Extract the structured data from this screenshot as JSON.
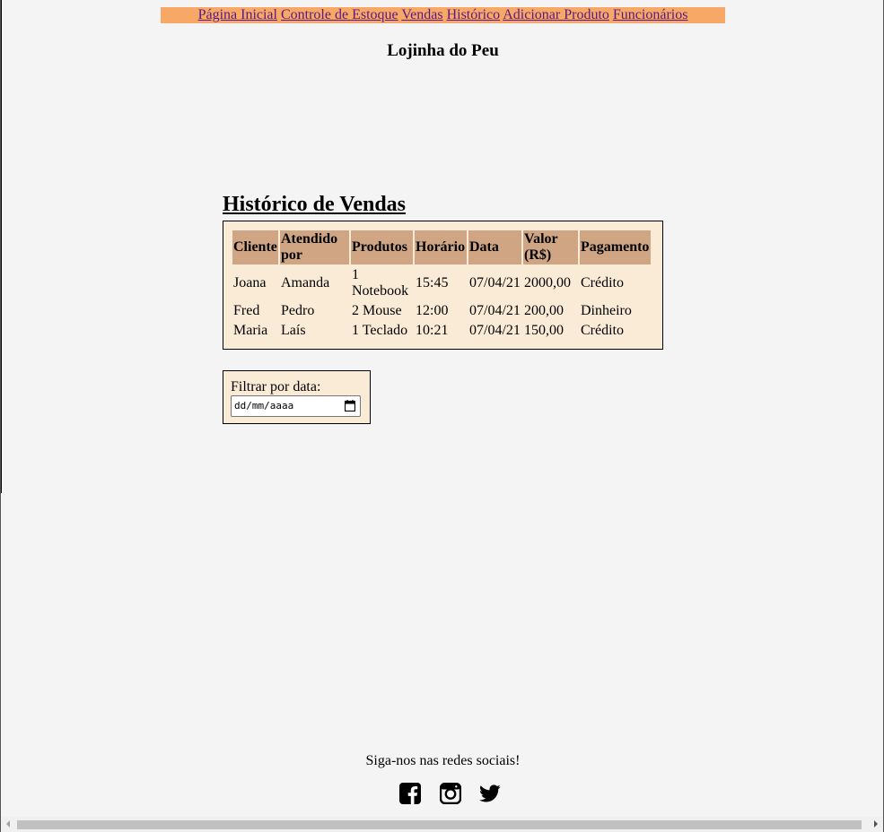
{
  "nav": {
    "items": [
      {
        "label": "Página Inicial"
      },
      {
        "label": "Controle de Estoque"
      },
      {
        "label": "Vendas"
      },
      {
        "label": "Histórico"
      },
      {
        "label": "Adicionar Produto"
      },
      {
        "label": "Funcionários"
      }
    ]
  },
  "site_title": "Lojinha do Peu",
  "history": {
    "title": "Histórico de Vendas",
    "columns": [
      "Cliente",
      "Atendido por",
      "Produtos",
      "Horário",
      "Data",
      "Valor (R$)",
      "Pagamento"
    ],
    "rows": [
      [
        "Joana",
        "Amanda",
        "1 Notebook",
        "15:45",
        "07/04/21",
        "2000,00",
        "Crédito"
      ],
      [
        "Fred",
        "Pedro",
        "2 Mouse",
        "12:00",
        "07/04/21",
        "200,00",
        "Dinheiro"
      ],
      [
        "Maria",
        "Laís",
        "1 Teclado",
        "10:21",
        "07/04/21",
        "150,00",
        "Crédito"
      ]
    ]
  },
  "filter": {
    "label": "Filtrar por data:",
    "value": "dd/mm/aaaa"
  },
  "footer": {
    "text": "Siga-nos nas redes sociais!",
    "icons": [
      "facebook-icon",
      "instagram-icon",
      "twitter-icon"
    ]
  },
  "colors": {
    "nav_bg": "#f7a866",
    "table_bg": "#faebd7",
    "header_bg": "#cfa584",
    "page_bg": "#f4f4f4",
    "link": "#551a8b"
  }
}
